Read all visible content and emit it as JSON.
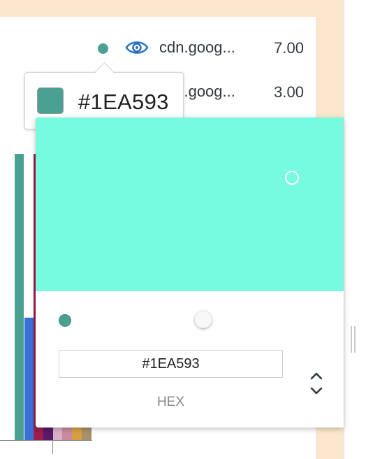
{
  "colors": {
    "selected": "#1EA593",
    "swatch_display": "#4aa093",
    "sv_area": "#76fbe0",
    "row2_dot": "#4a7fd9",
    "eye": "#2e6fbf"
  },
  "rows": [
    {
      "domain": "cdn.goog...",
      "value": "7.00",
      "dot_color": "#4aa093"
    },
    {
      "domain": "cdn.goog...",
      "value": "3.00",
      "dot_color": "#4a7fd9"
    }
  ],
  "tooltip": {
    "hex": "#1EA593"
  },
  "picker": {
    "hex_value": "#1EA593",
    "format_label": "HEX",
    "format_toggle_icon": "up-down-chevron-icon"
  },
  "chart_data": {
    "type": "bar",
    "segments": [
      {
        "color": "#4aa093"
      },
      {
        "color": "#3a6fd8"
      },
      {
        "color": "#9c1e4b"
      },
      {
        "color": "#5a1a6a"
      },
      {
        "color": "#d8b0c8"
      },
      {
        "color": "#c98aa0"
      },
      {
        "color": "#d4a040"
      },
      {
        "color": "#a8906a"
      }
    ]
  }
}
